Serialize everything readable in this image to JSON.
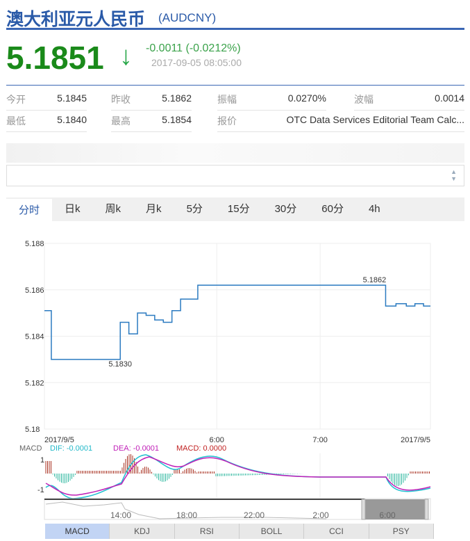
{
  "header": {
    "title": "澳大利亚元人民币",
    "code": "(AUDCNY)"
  },
  "quote": {
    "price": "5.1851",
    "change": "-0.0011 (-0.0212%)",
    "time": "2017-09-05 08:05:00",
    "direction": "down",
    "color": "#1a8a1a"
  },
  "stats": [
    [
      {
        "label": "今开",
        "value": "5.1845"
      },
      {
        "label": "昨收",
        "value": "5.1862"
      },
      {
        "label": "振幅",
        "value": "0.0270%"
      },
      {
        "label": "波幅",
        "value": "0.0014"
      }
    ],
    [
      {
        "label": "最低",
        "value": "5.1840"
      },
      {
        "label": "最高",
        "value": "5.1854"
      },
      {
        "label": "报价",
        "value": "OTC Data Services Editorial Team Calc..."
      }
    ]
  ],
  "tabs": [
    "分时",
    "日k",
    "周k",
    "月k",
    "5分",
    "15分",
    "30分",
    "60分",
    "4h"
  ],
  "active_tab": 0,
  "indicator_tabs": [
    "MACD",
    "KDJ",
    "RSI",
    "BOLL",
    "CCI",
    "PSY"
  ],
  "macd_legend": {
    "name": "MACD",
    "dif": "DIF: -0.0001",
    "dea": "DEA: -0.0001",
    "macd": "MACD: 0.0000",
    "ticks": [
      "1",
      "-1"
    ]
  },
  "navigator": {
    "ticks": [
      "14:00",
      "18:00",
      "22:00",
      "2:00",
      "6:00"
    ]
  },
  "chart_data": {
    "type": "line",
    "ylim": [
      5.18,
      5.188
    ],
    "yticks": [
      "5.188",
      "5.186",
      "5.184",
      "5.182",
      "5.18"
    ],
    "xlim": [
      "04:20",
      "08:04"
    ],
    "xticks": [
      {
        "t": "04:20",
        "label": "2017/9/5"
      },
      {
        "t": "06:00",
        "label": "6:00"
      },
      {
        "t": "07:00",
        "label": "7:00"
      },
      {
        "t": "08:04",
        "label": "2017/9/5"
      }
    ],
    "points": [
      [
        "04:20",
        5.1851
      ],
      [
        "04:24",
        5.1851
      ],
      [
        "04:24",
        5.183
      ],
      [
        "05:04",
        5.183
      ],
      [
        "05:04",
        5.1846
      ],
      [
        "05:09",
        5.1846
      ],
      [
        "05:09",
        5.1841
      ],
      [
        "05:14",
        5.1841
      ],
      [
        "05:14",
        5.185
      ],
      [
        "05:19",
        5.185
      ],
      [
        "05:19",
        5.1849
      ],
      [
        "05:24",
        5.1849
      ],
      [
        "05:24",
        5.1847
      ],
      [
        "05:29",
        5.1847
      ],
      [
        "05:29",
        5.1846
      ],
      [
        "05:34",
        5.1846
      ],
      [
        "05:34",
        5.1851
      ],
      [
        "05:39",
        5.1851
      ],
      [
        "05:39",
        5.1856
      ],
      [
        "05:49",
        5.1856
      ],
      [
        "05:49",
        5.1862
      ],
      [
        "07:38",
        5.1862
      ],
      [
        "07:38",
        5.1853
      ],
      [
        "07:44",
        5.1853
      ],
      [
        "07:44",
        5.1854
      ],
      [
        "07:50",
        5.1854
      ],
      [
        "07:50",
        5.1853
      ],
      [
        "07:55",
        5.1853
      ],
      [
        "07:55",
        5.1854
      ],
      [
        "08:00",
        5.1854
      ],
      [
        "08:00",
        5.1853
      ],
      [
        "08:04",
        5.1853
      ]
    ],
    "annotations": [
      {
        "t": "05:04",
        "value": "5.1830"
      },
      {
        "t": "07:38",
        "value": "5.1862"
      }
    ],
    "line_color": "#2a7ac0"
  }
}
